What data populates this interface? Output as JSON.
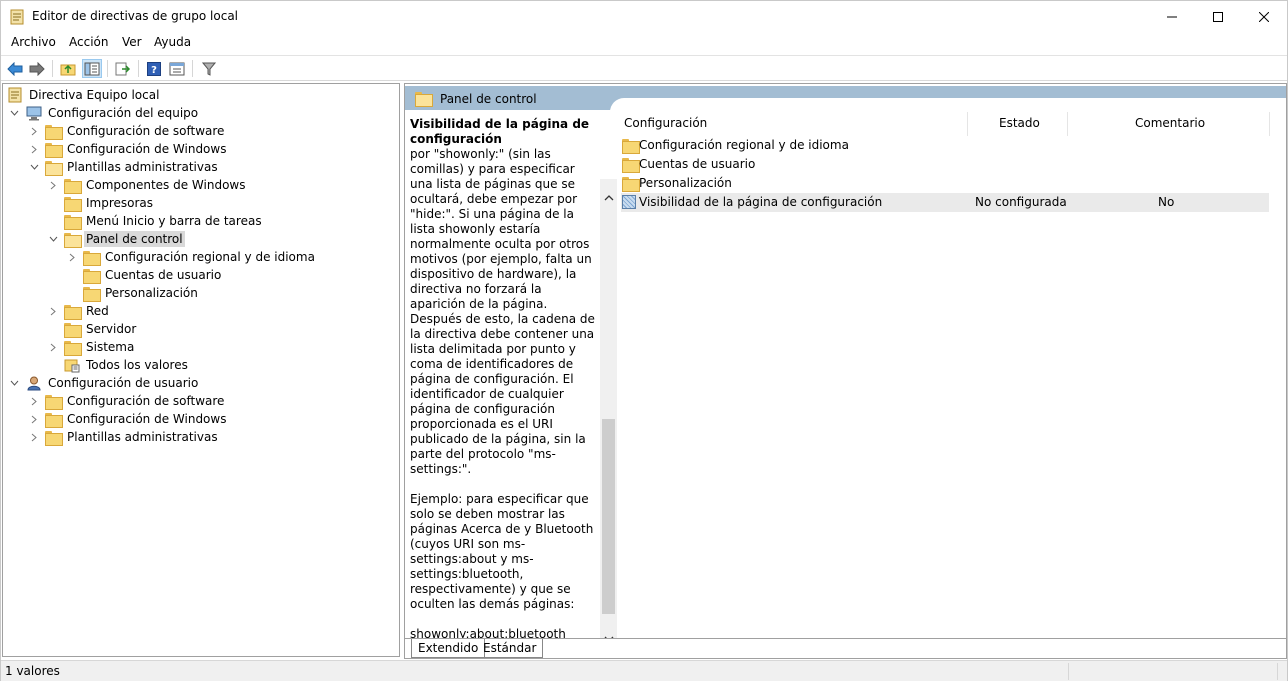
{
  "window": {
    "title": "Editor de directivas de grupo local"
  },
  "menu": [
    "Archivo",
    "Acción",
    "Ver",
    "Ayuda"
  ],
  "toolbar": {
    "icons": [
      "back-arrow-icon",
      "forward-arrow-icon",
      "up-folder-icon",
      "show-hide-tree-icon",
      "export-list-icon",
      "help-icon",
      "properties-icon",
      "filter-icon"
    ]
  },
  "tree": {
    "root": "Directiva Equipo local",
    "computer": "Configuración del equipo",
    "c_software": "Configuración de software",
    "c_windows": "Configuración de Windows",
    "c_admin": "Plantillas administrativas",
    "windows_components": "Componentes de Windows",
    "printers": "Impresoras",
    "start_menu": "Menú Inicio y barra de tareas",
    "control_panel": "Panel de control",
    "regional": "Configuración regional y de idioma",
    "user_accounts": "Cuentas de usuario",
    "personalization": "Personalización",
    "network": "Red",
    "server": "Servidor",
    "system": "Sistema",
    "all_values": "Todos los valores",
    "user": "Configuración de usuario",
    "u_software": "Configuración de software",
    "u_windows": "Configuración de Windows",
    "u_admin": "Plantillas administrativas"
  },
  "right": {
    "header_title": "Panel de control",
    "description_title": "Visibilidad de la página de configuración",
    "description_body": "por \"showonly:\" (sin las comillas) y para especificar una lista de páginas que se ocultará, debe empezar por \"hide:\". Si una página de la lista showonly estaría normalmente oculta por otros motivos (por ejemplo, falta un dispositivo de hardware), la directiva no forzará la aparición de la página. Después de esto, la cadena de la directiva debe contener una lista delimitada por punto y coma de identificadores de página de configuración. El identificador de cualquier página de configuración proporcionada es el URI publicado de la página, sin la parte del protocolo \"ms-settings:\".\n\nEjemplo: para especificar que solo se deben mostrar las páginas Acerca de y Bluetooth (cuyos URI son ms-settings:about y ms-settings:bluetooth, respectivamente) y que se oculten las demás páginas:\n\nshowonly:about;bluetooth\n\nEjemplo: para especificar que solo se debe ocultar la página Bluetooth (cuyo URI es ms-",
    "columns": {
      "setting": "Configuración",
      "state": "Estado",
      "comment": "Comentario"
    },
    "rows": [
      {
        "name": "Configuración regional y de idioma",
        "state": "",
        "comment": ""
      },
      {
        "name": "Cuentas de usuario",
        "state": "",
        "comment": ""
      },
      {
        "name": "Personalización",
        "state": "",
        "comment": ""
      },
      {
        "name": "Visibilidad de la página de configuración",
        "state": "No configurada",
        "comment": "No"
      }
    ],
    "tabs": {
      "extended": "Extendido",
      "standard": "Estándar"
    }
  },
  "status": {
    "text": "1 valores"
  },
  "colors": {
    "header_band": "#a3bdd3",
    "folder": "#f7d774",
    "selection": "#d9d9d9"
  }
}
